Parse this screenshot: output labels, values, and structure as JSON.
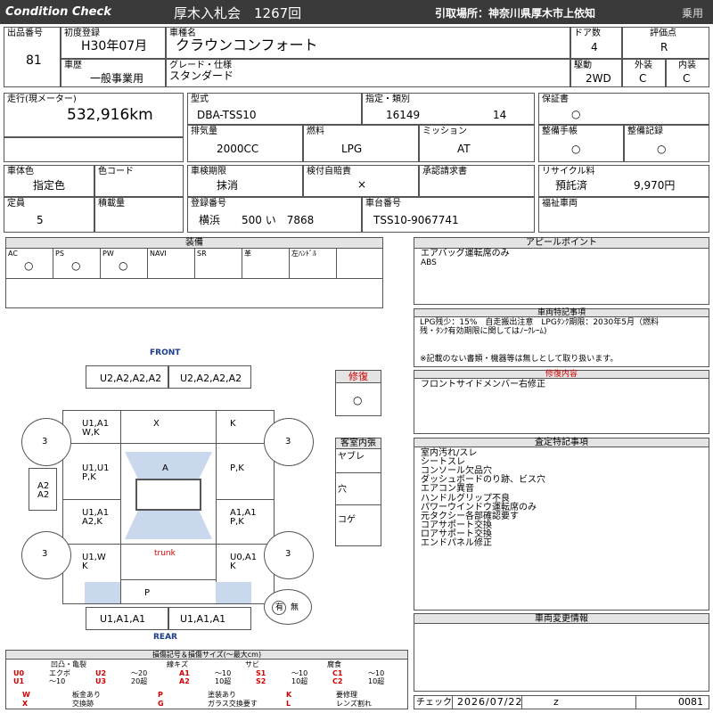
{
  "header": {
    "title": "Condition  Check",
    "auction": "厚木入札会　1267回",
    "pickup": "引取場所：神奈川県厚木市上依知",
    "usage": "乗用"
  },
  "row1": {
    "lot_label": "出品番号",
    "lot": "81",
    "first_reg_label": "初度登録",
    "first_reg": "H30年07月",
    "car_name_label": "車種名",
    "car_name": "クラウンコンフォート",
    "doors_label": "ドア数",
    "doors": "4",
    "score_label": "評価点",
    "score": "R",
    "history_label": "車歴",
    "history": "一般事業用",
    "grade_label": "グレード・仕様",
    "grade": "スタンダード",
    "drive_label": "駆動",
    "drive": "2WD",
    "ext_label": "外装",
    "ext": "C",
    "int_label": "内装",
    "int": "C"
  },
  "info": {
    "mileage_label": "走行(現メーター)",
    "mileage": "532,916km",
    "model_label": "型式",
    "model": "DBA-TSS10",
    "class_label": "指定・類別",
    "class_a": "16149",
    "class_b": "14",
    "warranty_label": "保証書",
    "warranty": "○",
    "displacement_label": "排気量",
    "displacement": "2000CC",
    "fuel_label": "燃料",
    "fuel": "LPG",
    "mission_label": "ミッション",
    "mission": "AT",
    "manual_label": "整備手帳",
    "manual": "○",
    "record_label": "整備記録",
    "record": "○",
    "color_label": "車体色",
    "color": "指定色",
    "color_code_label": "色コード",
    "color_code": "",
    "inspection_label": "車検期限",
    "inspection": "抹消",
    "auto_inspect_label": "検付自賠責",
    "auto_inspect": "×",
    "approval_label": "承認請求書",
    "approval": "",
    "recycle_label": "リサイクル料",
    "recycle_status": "預託済",
    "recycle_fee": "9,970円",
    "capacity_label": "定員",
    "capacity": "5",
    "load_label": "積載量",
    "load": "",
    "reg_no_label": "登録番号",
    "reg_no": "横浜　　500 い　7868",
    "chassis_label": "車台番号",
    "chassis": "TSS10-9067741",
    "welfare_label": "福祉車両",
    "welfare": ""
  },
  "equipment": {
    "title": "装備",
    "cols": [
      {
        "name": "AC",
        "mark": "○"
      },
      {
        "name": "PS",
        "mark": "○"
      },
      {
        "name": "PW",
        "mark": "○"
      },
      {
        "name": "NAVI",
        "mark": ""
      },
      {
        "name": "SR",
        "mark": ""
      },
      {
        "name": "革",
        "mark": ""
      },
      {
        "name": "左ﾊﾝﾄﾞﾙ",
        "mark": ""
      }
    ]
  },
  "appeal": {
    "title": "アピールポイント",
    "lines": [
      "エアバッグ運転席のみ",
      "ABS"
    ]
  },
  "notes": {
    "title": "車両特記事項",
    "lines": [
      "LPG残少：15%　自走搬出注意　LPGﾀﾝｸ期限：2030年5月（燃料",
      "残・ﾀﾝｸ有効期限に関してはﾉｰｸﾚｰﾑ)",
      "",
      "※記載のない書類・機器等は無しとして取り扱います。"
    ]
  },
  "repair": {
    "title": "修復",
    "mark": "○"
  },
  "repair_detail": {
    "title": "修復内容",
    "lines": [
      "フロントサイドメンバー右修正"
    ]
  },
  "cabin": {
    "title": "客室内張",
    "rows": [
      "ヤブレ",
      "穴",
      "コゲ"
    ]
  },
  "assessment": {
    "title": "査定特記事項",
    "lines": [
      "室内汚れ/スレ",
      "シートスレ",
      "コンソール欠品穴",
      "ダッシュボードのり跡、ビス穴",
      "エアコン異音",
      "ハンドルグリップ不良",
      "パワーウインドウ運転席のみ",
      "元タクシー各部確認要す",
      "コアサポート交換",
      "ロアサポート交換",
      "エンドパネル修正"
    ]
  },
  "change": {
    "title": "車両変更情報",
    "lines": []
  },
  "diagram": {
    "front": "FRONT",
    "rear": "REAR",
    "front_left_bumper": "U2,A2,A2,A2",
    "front_right_bumper": "U2,A2,A2,A2",
    "fl_fender": "U1,A1\nW,K",
    "hood": "X",
    "fr_fender": "K",
    "fl_door": "U1,U1\nP,K",
    "roof": "A",
    "fr_door": "P,K",
    "rl_door": "U1,A1\nA2,K",
    "rr_door": "A1,A1\nP,K",
    "rl_quarter": "U1,W\nK",
    "trunk": "trunk",
    "rr_quarter": "U0,A1\nK",
    "rear_panel": "P",
    "rear_left_bumper": "U1,A1,A1",
    "rear_right_bumper": "U1,A1,A1",
    "left_side": "A2\nA2",
    "tire_fl": "3",
    "tire_fr": "3",
    "tire_rl": "3",
    "tire_rr": "3",
    "spare_a": "有",
    "spare_b": "無"
  },
  "legend": {
    "title": "損傷記号＆損傷サイズ(〜最大cm)",
    "groups": [
      "凹凸・亀裂",
      "線キズ",
      "サビ",
      "腐食"
    ],
    "rows": [
      [
        [
          "U0",
          "エクボ"
        ],
        [
          "U2",
          "〜20"
        ],
        [
          "A1",
          "〜10"
        ],
        [
          "S1",
          "〜10"
        ],
        [
          "C1",
          "〜10"
        ]
      ],
      [
        [
          "U1",
          "〜10"
        ],
        [
          "U3",
          "20超"
        ],
        [
          "A2",
          "10超"
        ],
        [
          "S2",
          "10超"
        ],
        [
          "C2",
          "10超"
        ]
      ]
    ],
    "marks": [
      [
        [
          "W",
          "板金あり"
        ],
        [
          "P",
          "塗装あり"
        ],
        [
          "K",
          "要修理"
        ]
      ],
      [
        [
          "X",
          "交換跡"
        ],
        [
          "G",
          "ガラス交換要す"
        ],
        [
          "L",
          "レンズ割れ"
        ]
      ]
    ]
  },
  "footer": {
    "check_label": "チェック",
    "date": "2026/07/22",
    "z": "z",
    "number": "0081"
  }
}
